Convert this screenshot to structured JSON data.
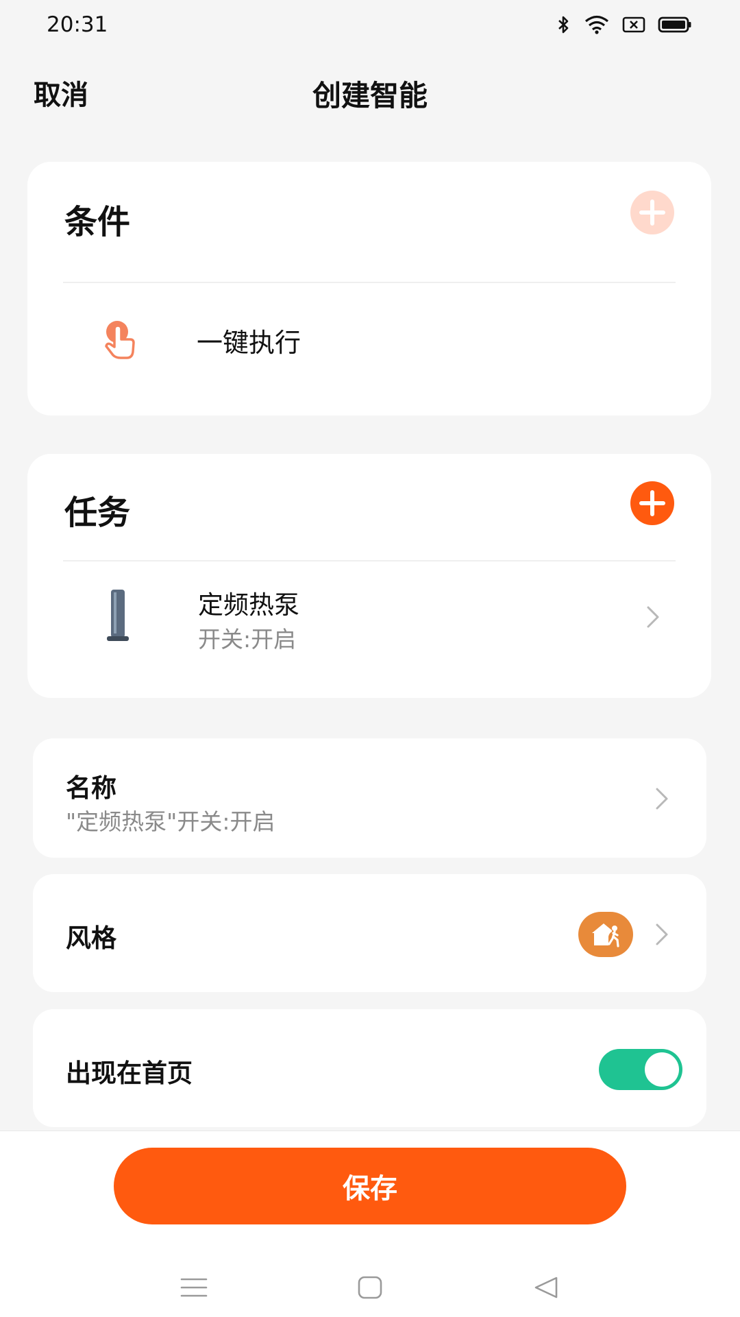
{
  "status_bar": {
    "time": "20:31",
    "icons": [
      "bluetooth-icon",
      "wifi-icon",
      "sim-x-icon",
      "battery-icon"
    ]
  },
  "header": {
    "cancel_label": "取消",
    "title": "创建智能"
  },
  "conditions": {
    "title": "条件",
    "add_icon": "plus-circle-icon",
    "add_color": "#ffd9cc",
    "items": [
      {
        "icon": "tap-hand-icon",
        "label": "一键执行"
      }
    ]
  },
  "tasks": {
    "title": "任务",
    "add_icon": "plus-circle-icon",
    "add_color": "#ff5a0f",
    "items": [
      {
        "icon": "heat-pump-device-icon",
        "name": "定频热泵",
        "detail": "开关:开启"
      }
    ]
  },
  "settings": {
    "name": {
      "label": "名称",
      "value": "\"定频热泵\"开关:开启"
    },
    "style": {
      "label": "风格",
      "icon": "home-person-icon",
      "icon_color": "#e88a3a"
    },
    "show_on_home": {
      "label": "出现在首页",
      "enabled": true,
      "color": "#1fc392"
    }
  },
  "save_label": "保存",
  "accent_color": "#ff5a0f",
  "nav_bar": [
    "menu-icon",
    "home-square-icon",
    "back-triangle-icon"
  ]
}
